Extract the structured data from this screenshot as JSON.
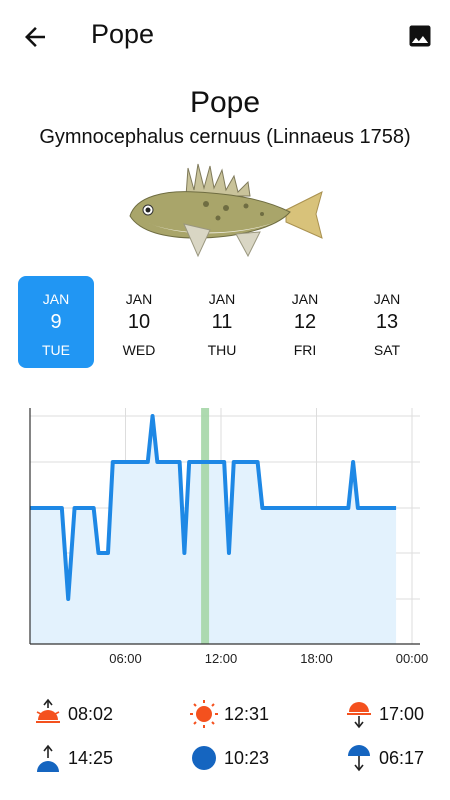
{
  "appbar": {
    "title": "Pope",
    "back_icon": "arrow-back-icon",
    "gallery_icon": "image-icon"
  },
  "species": {
    "name": "Pope",
    "scientific": "Gymnocephalus cernuus (Linnaeus 1758)",
    "image": "fish-illustration"
  },
  "days": [
    {
      "month": "JAN",
      "day": "9",
      "weekday": "TUE",
      "selected": true
    },
    {
      "month": "JAN",
      "day": "10",
      "weekday": "WED",
      "selected": false
    },
    {
      "month": "JAN",
      "day": "11",
      "weekday": "THU",
      "selected": false
    },
    {
      "month": "JAN",
      "day": "12",
      "weekday": "FRI",
      "selected": false
    },
    {
      "month": "JAN",
      "day": "13",
      "weekday": "SAT",
      "selected": false
    }
  ],
  "colors": {
    "accent": "#2196f3",
    "line": "#1e88e5",
    "fill": "#e3f2fd",
    "now": "#a5d6a7",
    "sun": "#f4511e",
    "moon": "#1565c0"
  },
  "chart_data": {
    "type": "area",
    "xticks": [
      "06:00",
      "12:00",
      "18:00",
      "00:00"
    ],
    "xrange_hours": [
      0,
      24
    ],
    "now_hour": 11.0,
    "points": [
      [
        0,
        3
      ],
      [
        2,
        3
      ],
      [
        2.4,
        1
      ],
      [
        2.8,
        3
      ],
      [
        4,
        3
      ],
      [
        4.3,
        2
      ],
      [
        4.9,
        2
      ],
      [
        5.2,
        4
      ],
      [
        7.4,
        4
      ],
      [
        7.7,
        5
      ],
      [
        8.0,
        4
      ],
      [
        9.4,
        4
      ],
      [
        9.7,
        2
      ],
      [
        10.0,
        4
      ],
      [
        12.2,
        4
      ],
      [
        12.5,
        2
      ],
      [
        12.8,
        4
      ],
      [
        14.3,
        4
      ],
      [
        14.6,
        3
      ],
      [
        20.0,
        3
      ],
      [
        20.3,
        4
      ],
      [
        20.6,
        3
      ],
      [
        23.0,
        3
      ]
    ]
  },
  "sun": {
    "sunrise": "08:02",
    "noon": "12:31",
    "sunset": "17:00"
  },
  "moon": {
    "moonrise": "14:25",
    "transit": "10:23",
    "moonset": "06:17"
  }
}
